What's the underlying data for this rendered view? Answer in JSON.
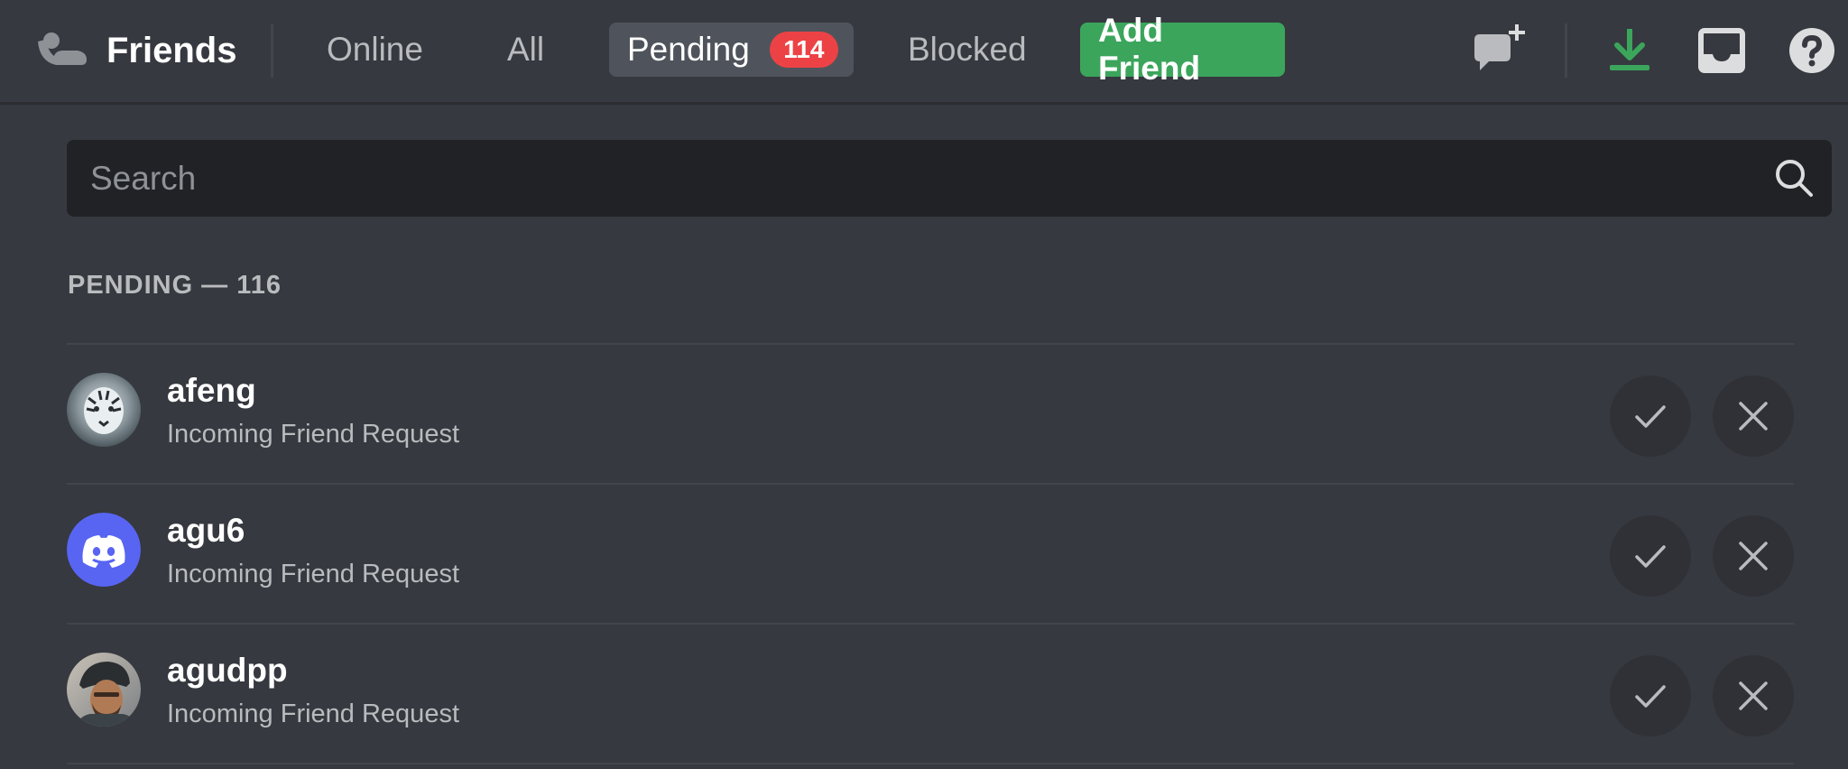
{
  "header": {
    "title": "Friends",
    "tabs": [
      {
        "label": "Online"
      },
      {
        "label": "All"
      },
      {
        "label": "Pending",
        "badge": "114"
      },
      {
        "label": "Blocked"
      }
    ],
    "add_friend_label": "Add Friend",
    "icons": [
      "friends-icon",
      "new-group-dm-icon",
      "download-icon",
      "inbox-icon",
      "help-icon"
    ]
  },
  "search": {
    "placeholder": "Search"
  },
  "section": {
    "title": "PENDING — 116"
  },
  "requests": [
    {
      "name": "afeng",
      "status": "Incoming Friend Request",
      "avatar": "tiger-photo-avatar"
    },
    {
      "name": "agu6",
      "status": "Incoming Friend Request",
      "avatar": "discord-default-avatar"
    },
    {
      "name": "agudpp",
      "status": "Incoming Friend Request",
      "avatar": "person-photo-avatar"
    }
  ],
  "colors": {
    "background": "#36393f",
    "search_bg": "#202225",
    "badge_red": "#ed4245",
    "add_friend_green": "#3ba55c",
    "blurple": "#5865f2",
    "download_green": "#3ba55c"
  }
}
